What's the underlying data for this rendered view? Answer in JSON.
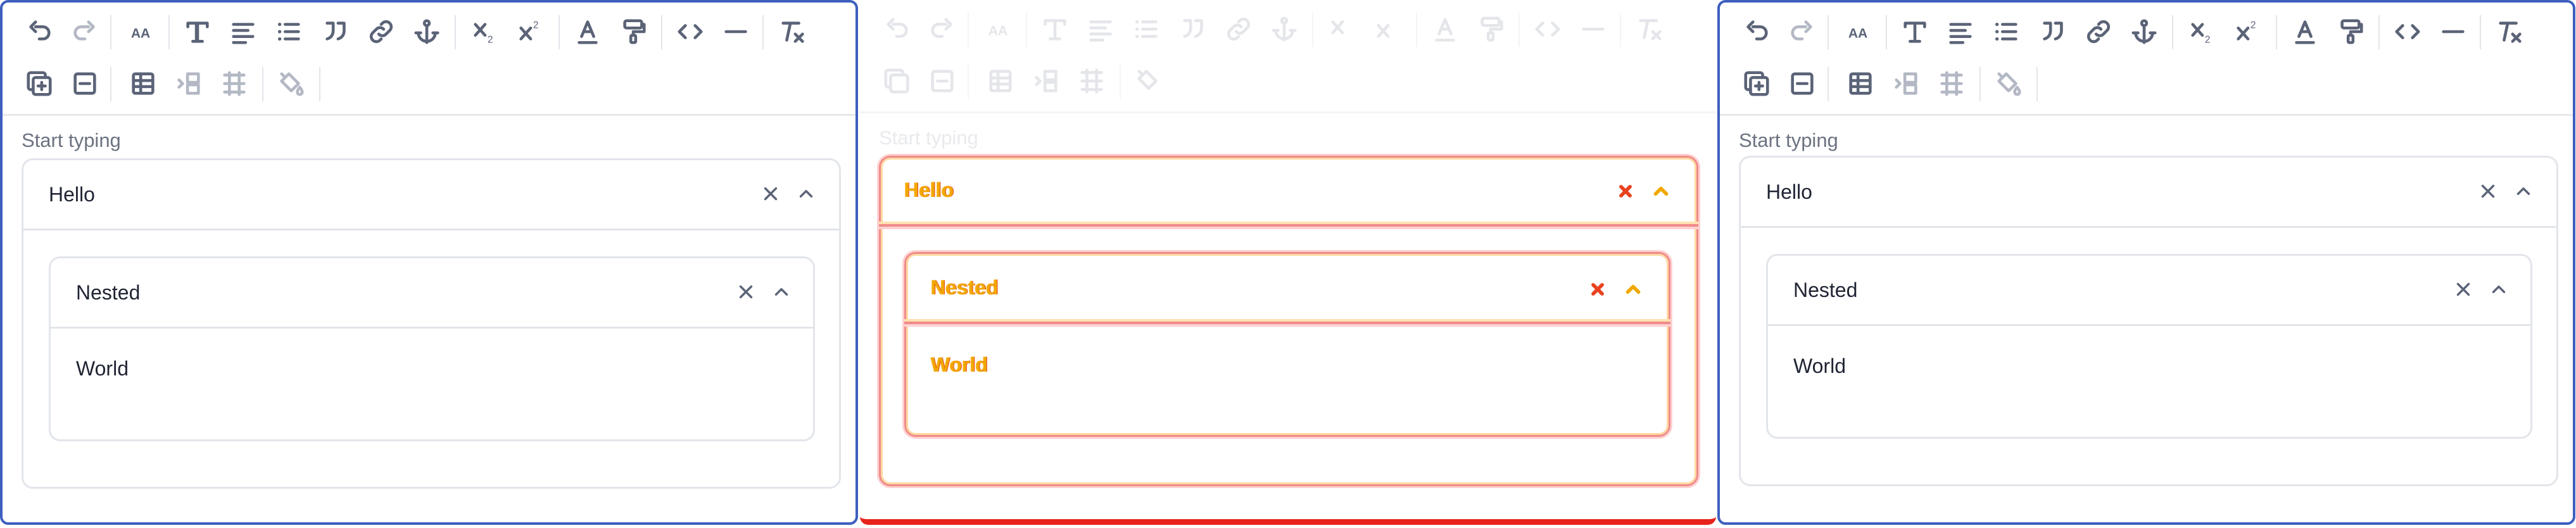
{
  "editor": {
    "placeholder": "Start typing",
    "accordion": {
      "title": "Hello",
      "nested": {
        "title": "Nested",
        "body": "World"
      }
    }
  },
  "toolbar_icons": {
    "row1": [
      "undo-icon",
      "redo-icon",
      "font-size-icon",
      "heading-icon",
      "align-icon",
      "bullet-list-icon",
      "blockquote-icon",
      "link-icon",
      "anchor-icon",
      "subscript-icon",
      "superscript-icon",
      "text-color-icon",
      "highlight-icon",
      "code-icon",
      "horizontal-rule-icon",
      "clear-format-icon"
    ],
    "row2": [
      "add-block-icon",
      "remove-block-icon",
      "table-icon",
      "add-column-icon",
      "add-row-icon",
      "fill-color-icon"
    ],
    "labels": {
      "subscript": "x",
      "superscript": "x",
      "font_size": "AA"
    }
  },
  "colors": {
    "active_border": "#3d5fbe",
    "error_border": "#e8231c",
    "diff_text": "#f0a800",
    "icon": "#5b6377"
  }
}
